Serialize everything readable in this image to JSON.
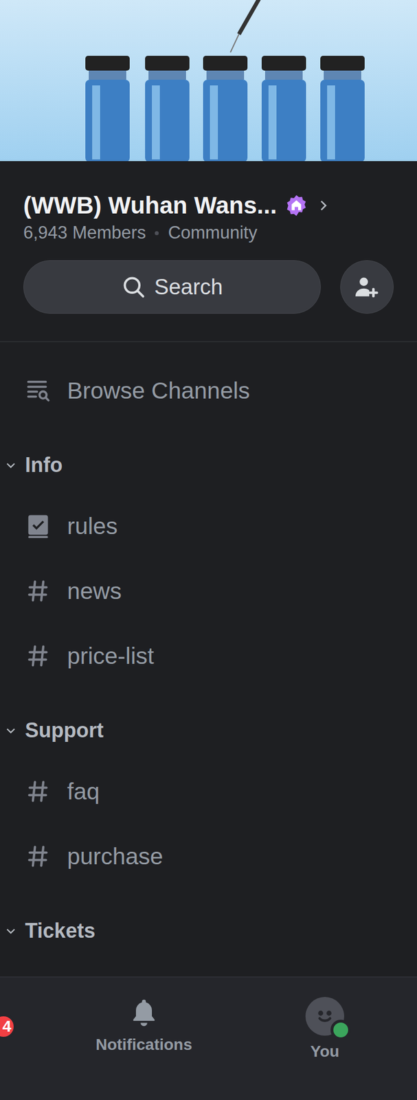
{
  "server": {
    "name": "(WWB) Wuhan Wans...",
    "members": "6,943 Members",
    "type": "Community",
    "boosted": true
  },
  "search": {
    "placeholder": "Search"
  },
  "browse": {
    "label": "Browse Channels"
  },
  "categories": [
    {
      "name": "Info",
      "expanded": true,
      "channels": [
        {
          "name": "rules",
          "kind": "rules"
        },
        {
          "name": "news",
          "kind": "text"
        },
        {
          "name": "price-list",
          "kind": "text"
        }
      ]
    },
    {
      "name": "Support",
      "expanded": true,
      "channels": [
        {
          "name": "faq",
          "kind": "text"
        },
        {
          "name": "purchase",
          "kind": "text"
        }
      ]
    },
    {
      "name": "Tickets",
      "expanded": true,
      "channels": []
    }
  ],
  "nav": [
    {
      "label": "Notifications",
      "kind": "bell",
      "selected": false
    },
    {
      "label": "You",
      "kind": "avatar",
      "selected": false,
      "online": true
    }
  ],
  "nav_badge": "4"
}
